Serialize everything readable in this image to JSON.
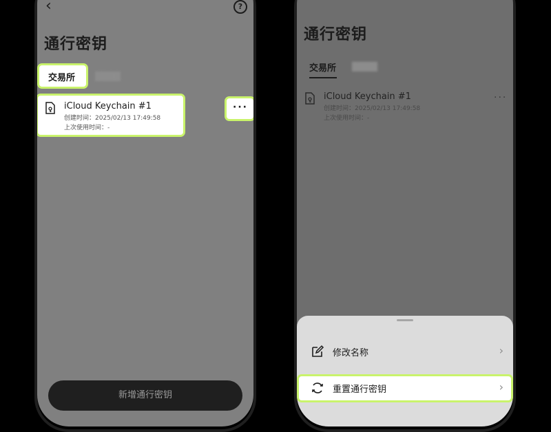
{
  "left_screen": {
    "back_icon": "‹",
    "help_icon": "?",
    "title": "通行密钥",
    "tab_active": "交易所",
    "tab_inactive": "████",
    "item": {
      "title": "iCloud Keychain #1",
      "created": "创建时间：2025/02/13 17:49:58",
      "last_used": "上次使用时间：-"
    },
    "more_label": "···",
    "add_button": "新增通行密钥"
  },
  "right_screen": {
    "title": "通行密钥",
    "tab_active": "交易所",
    "tab_inactive": "████",
    "item": {
      "title": "iCloud Keychain #1",
      "created": "创建时间：2025/02/13 17:49:58",
      "last_used": "上次使用时间：-"
    },
    "more_label": "···",
    "sheet": {
      "rename_label": "修改名称",
      "reset_label": "重置通行密钥"
    }
  },
  "colors": {
    "highlight": "#c9f36b",
    "overlay": "#808080",
    "sheet": "#dcdcdc"
  }
}
